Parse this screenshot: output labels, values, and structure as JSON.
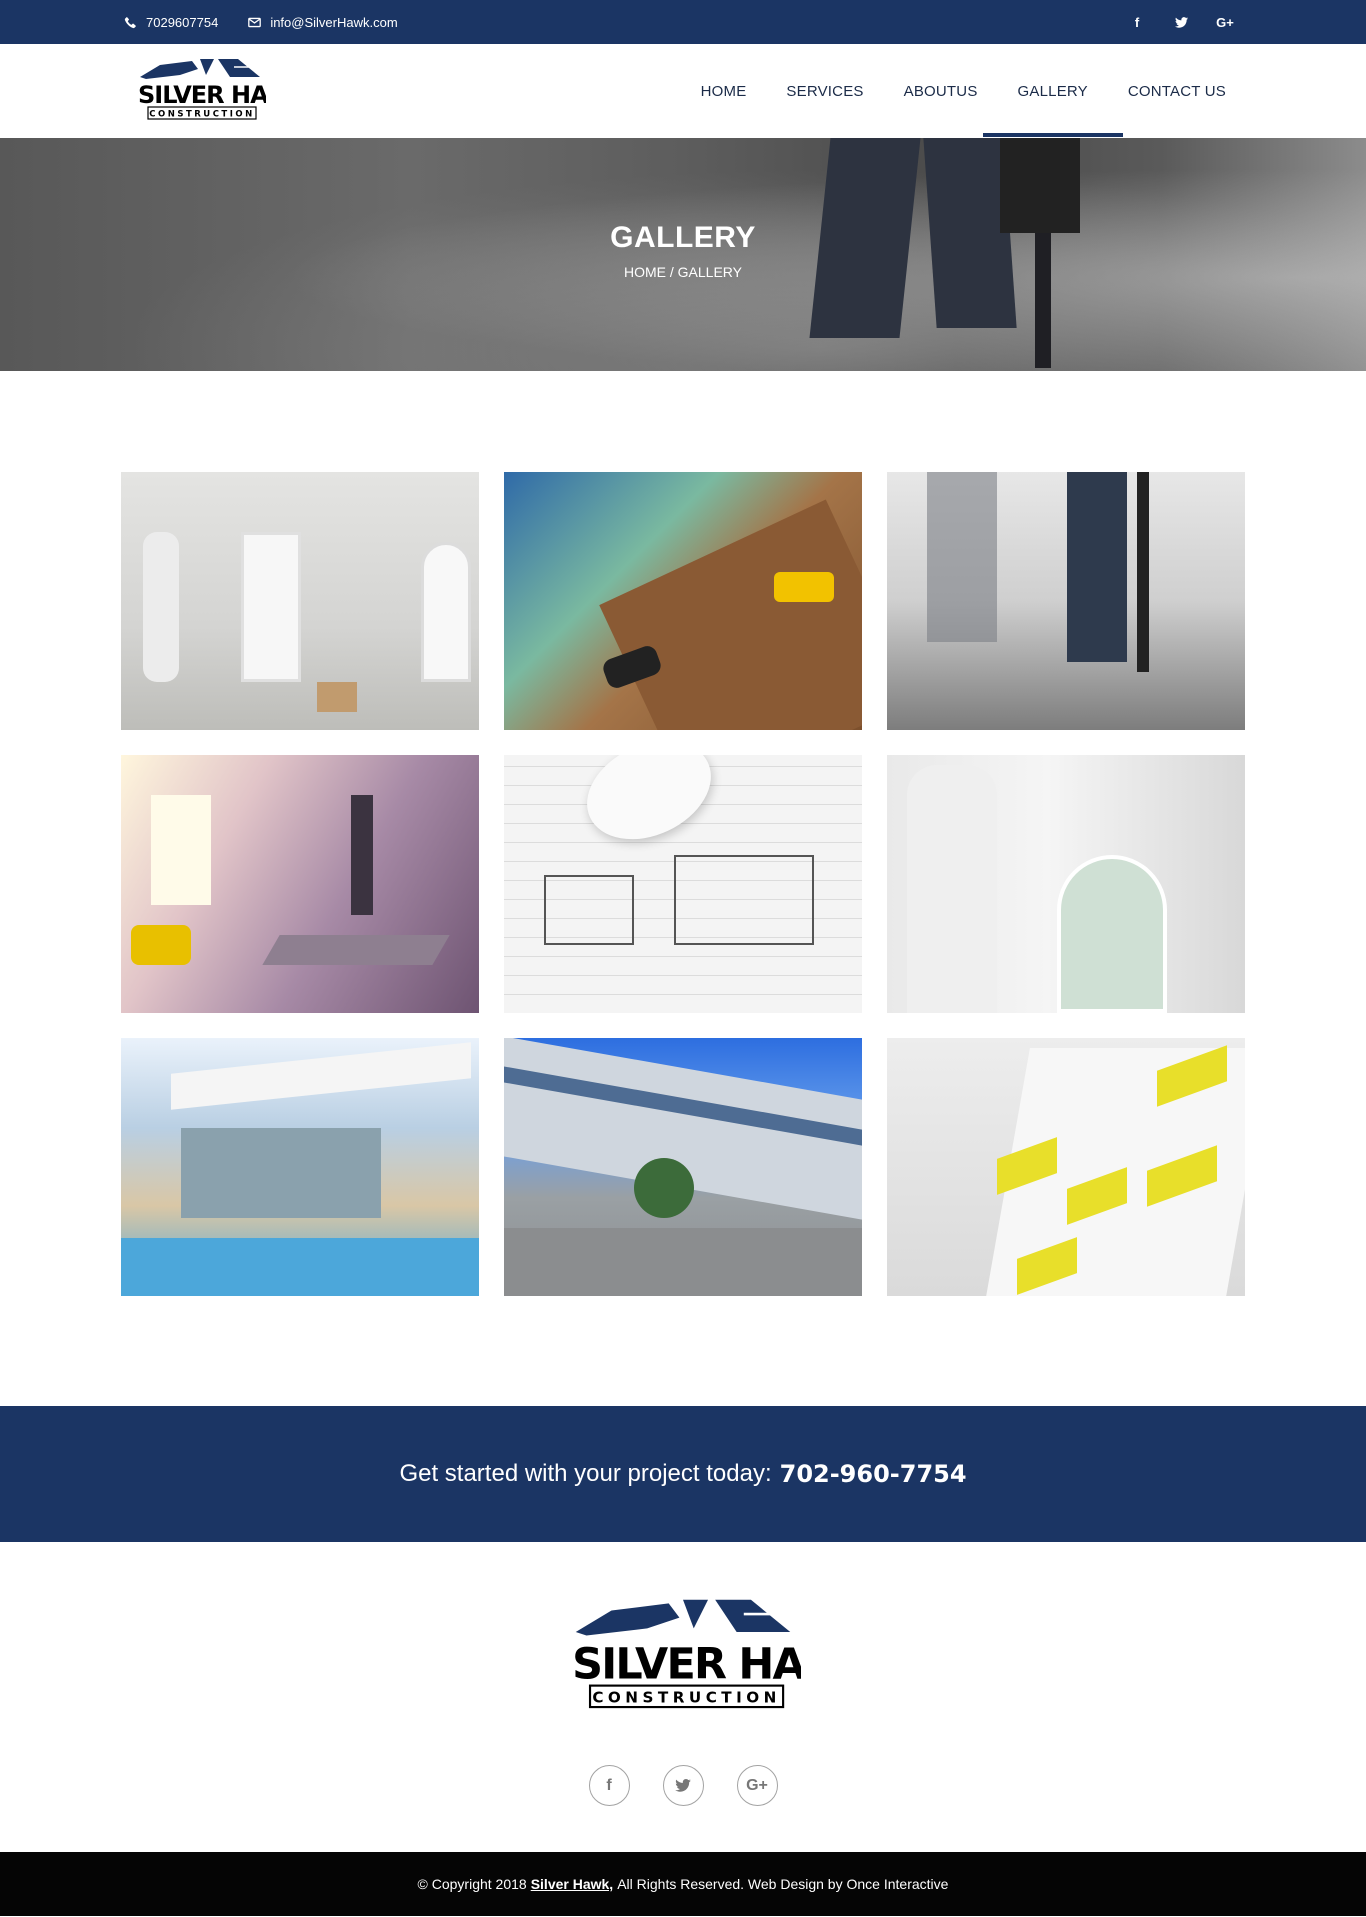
{
  "topbar": {
    "phone": "7029607754",
    "email": "info@SilverHawk.com",
    "social": [
      {
        "icon": "facebook-icon",
        "glyph": "f"
      },
      {
        "icon": "twitter-icon",
        "glyph": "t"
      },
      {
        "icon": "google-plus-icon",
        "glyph": "G+"
      }
    ]
  },
  "logo": {
    "line1": "SILVER HAWK",
    "line2": "CONSTRUCTION"
  },
  "nav": {
    "items": [
      "HOME",
      "SERVICES",
      "ABOUTUS",
      "GALLERY",
      "CONTACT US"
    ],
    "active": "GALLERY"
  },
  "hero": {
    "title": "GALLERY",
    "breadcrumb": "HOME / GALLERY"
  },
  "gallery": {
    "images": [
      "painters-interior-room",
      "laying-wood-flooring",
      "jackhammer-workers",
      "drywall-renovation",
      "blueprint-plans",
      "painter-wall-arched-window",
      "modern-house-pool",
      "office-building-exterior",
      "yellow-balcony-building"
    ]
  },
  "cta": {
    "text": "Get started with your project today:",
    "phone": "702-960-7754"
  },
  "footer": {
    "social": [
      {
        "icon": "facebook-icon",
        "glyph": "f"
      },
      {
        "icon": "twitter-icon",
        "glyph": "t"
      },
      {
        "icon": "google-plus-icon",
        "glyph": "G+"
      }
    ]
  },
  "copyright": {
    "prefix": "© Copyright 2018",
    "brand": "Silver Hawk,",
    "suffix": "All Rights Reserved. Web Design by Once Interactive"
  },
  "colors": {
    "primary": "#1b3564",
    "dark": "#050505",
    "white": "#ffffff"
  }
}
